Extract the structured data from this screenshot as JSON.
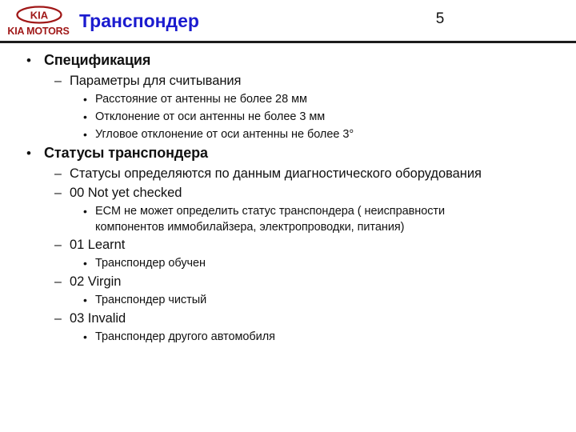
{
  "header": {
    "logo_wordmark": "KIA MOTORS",
    "logo_oval_text": "KIA",
    "title": "Транспондер",
    "page_number": "5",
    "title_color": "#1b1bcf",
    "logo_color": "#a01818",
    "rule_color": "#1c1c1c"
  },
  "content": {
    "items": [
      {
        "level": 1,
        "bullet": "•",
        "text": "Спецификация"
      },
      {
        "level": 2,
        "bullet": "–",
        "text": "Параметры для считывания"
      },
      {
        "level": 3,
        "bullet": "•",
        "text": "Расстояние от антенны не более 28 мм"
      },
      {
        "level": 3,
        "bullet": "•",
        "text": "Отклонение от оси антенны не более 3 мм"
      },
      {
        "level": 3,
        "bullet": "•",
        "text": "Угловое отклонение от оси антенны не более 3°"
      },
      {
        "level": 1,
        "bullet": "•",
        "text": "Статусы транспондера"
      },
      {
        "level": 2,
        "bullet": "–",
        "text": "Статусы определяются по данным диагностического оборудования"
      },
      {
        "level": 2,
        "bullet": "–",
        "text": "00 Not yet checked"
      },
      {
        "level": 3,
        "bullet": "•",
        "text": "ECM не может определить статус транспондера ( неисправности компонентов иммобилайзера, электропроводки, питания)"
      },
      {
        "level": 2,
        "bullet": "–",
        "text": "01 Learnt"
      },
      {
        "level": 3,
        "bullet": "•",
        "text": "Транспондер обучен"
      },
      {
        "level": 2,
        "bullet": "–",
        "text": "02 Virgin"
      },
      {
        "level": 3,
        "bullet": "•",
        "text": "Транспондер чистый"
      },
      {
        "level": 2,
        "bullet": "–",
        "text": "03 Invalid"
      },
      {
        "level": 3,
        "bullet": "•",
        "text": "Транспондер другого автомобиля"
      }
    ]
  }
}
